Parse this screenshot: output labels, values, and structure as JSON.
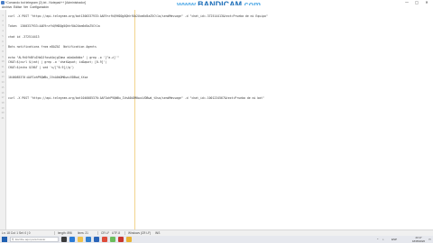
{
  "window": {
    "title": "*Comando bot telegram (2).txt - Notepad++ [Administrador]",
    "min": "—",
    "max": "□",
    "close": "✕"
  },
  "watermark": {
    "part1": "www.",
    "part2": "BANDICAM",
    "part3": ".com"
  },
  "menu": [
    "Archivo",
    "Editar",
    "Ver",
    "Configuración"
  ],
  "editor": {
    "line_numbers": [
      "1",
      "2",
      "3",
      "4",
      "5",
      "6",
      "7",
      "8",
      "9",
      "10",
      "11",
      "12",
      "13",
      "14",
      "15",
      "16",
      "17",
      "18",
      "19",
      "20",
      "21"
    ],
    "lines": [
      "curl -X POST \"https://api.telegram.org/bot1300337933:AAE9rzfhQ9HDQg5QhhfOb2Uxm6d5aZ5Ct1a/sendMessage\" -d \"chat_id=-372514413&text=Prueba de mi Equipo\"",
      "",
      "Token  1300337933:AAE9rzfhQ9HDQg5QhhfOb2Uxm6d5aZ5Ct1a",
      "",
      "chat id -372514413",
      "",
      "Bots notifications from eDAZAI  Notification Agents",
      "",
      "echo \"ALfhOfhBYuIHxDJfosd4ojgIbmz aAaAa0dbx\" | grep -o '[^a-z]'\"",
      "CHAT=$(curl $(cat) | grep -o 'chat&quot; id&quot; [0-9]')",
      "CHAT=$(echo $CHAT | sed 's/[^0-9]//g')",
      "",
      "1046085370:AAFIohP9QWBu_IVnA0kDM0wxiVDBwd_tXsa",
      "",
      "",
      "",
      "curl -X POST \"https://api.telegram.org/bot1046085370:AAFIohP9QWBu_IVnA0kDM0wxiVDBwd_tXsa/sendMessage\" -d \"chat_id=-1001234567&text=Prueba de mi bot\"",
      "",
      "",
      "",
      ""
    ]
  },
  "status": {
    "position": "Ln: 18   Col: 1   Sel: 0 | 0",
    "length": "length: 896",
    "lines": "lines: 21",
    "eol": "CR LF",
    "encoding": "UTF-8",
    "mode": "Windows (CR LF)",
    "ins": "INS"
  },
  "taskbar": {
    "search_placeholder": "Escribe aquí para buscar",
    "apps": [
      {
        "name": "task-view",
        "color": "#3b3b3b"
      },
      {
        "name": "edge",
        "color": "#2b7bd6"
      },
      {
        "name": "explorer",
        "color": "#f0c24b"
      },
      {
        "name": "store",
        "color": "#2f7fd0"
      },
      {
        "name": "mail",
        "color": "#2a64b8"
      },
      {
        "name": "chrome",
        "color": "#dd4b39"
      },
      {
        "name": "notepad-plus-plus",
        "color": "#6bbd5b"
      },
      {
        "name": "bandicam",
        "color": "#c8362f"
      },
      {
        "name": "folder",
        "color": "#e8b233"
      }
    ],
    "tray_lang": "ESP",
    "tray_up": "^",
    "time": "23:17",
    "date": "18/05/2020"
  }
}
